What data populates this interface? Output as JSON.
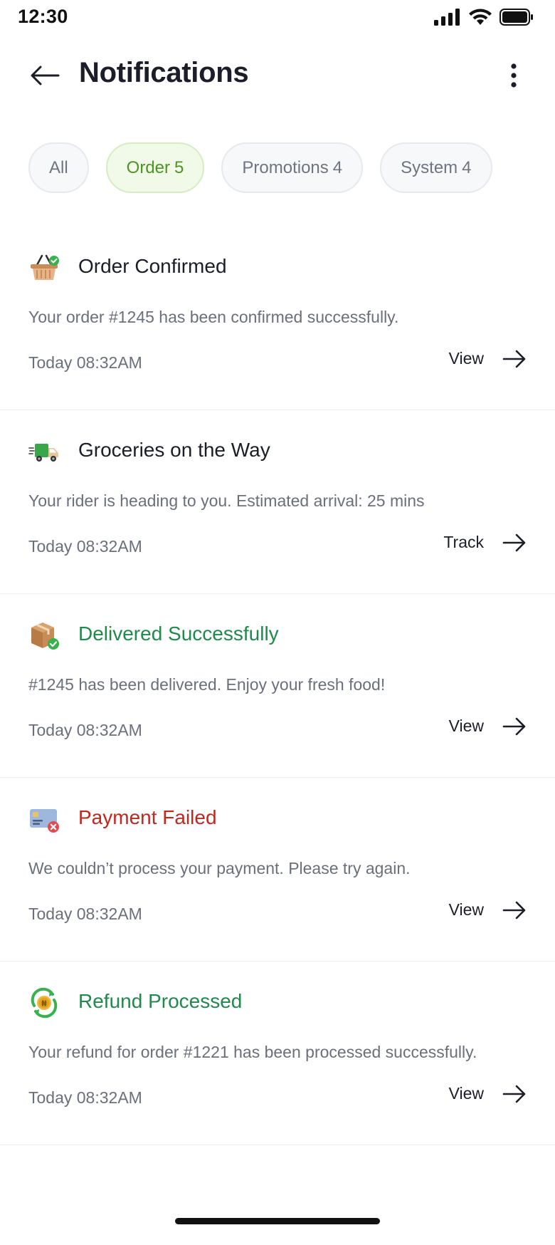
{
  "status_bar": {
    "time": "12:30"
  },
  "header": {
    "title": "Notifications"
  },
  "filters": [
    {
      "label": "All",
      "count": ""
    },
    {
      "label": "Order",
      "count": "5"
    },
    {
      "label": "Promotions",
      "count": "4"
    },
    {
      "label": "System",
      "count": "4"
    }
  ],
  "active_filter": "Order",
  "notifications": [
    {
      "icon": "basket-check-icon",
      "title": "Order Confirmed",
      "title_color": "#1b1e28",
      "message": "Your order #1245 has been confirmed successfully.",
      "time": "Today 08:32AM",
      "action": "View"
    },
    {
      "icon": "delivery-truck-icon",
      "title": "Groceries on the Way",
      "title_color": "#1b1e28",
      "message": "Your rider is heading to you. Estimated arrival: 25 mins",
      "time": "Today 08:32AM",
      "action": "Track"
    },
    {
      "icon": "package-check-icon",
      "title": "Delivered Successfully",
      "title_color": "#1f8a4c",
      "message": "#1245 has been delivered. Enjoy your fresh food!",
      "time": "Today 08:32AM",
      "action": "View"
    },
    {
      "icon": "card-error-icon",
      "title": "Payment Failed",
      "title_color": "#c0281f",
      "message": "We couldn’t process your payment. Please try again.",
      "time": "Today 08:32AM",
      "action": "View"
    },
    {
      "icon": "refund-coin-icon",
      "title": "Refund Processed",
      "title_color": "#1f8a4c",
      "message": "Your refund for order #1221 has been processed successfully.",
      "time": "Today 08:32AM",
      "action": "View"
    }
  ],
  "colors": {
    "accent_green": "#4f9325",
    "success": "#1f8a4c",
    "error": "#c0281f"
  }
}
